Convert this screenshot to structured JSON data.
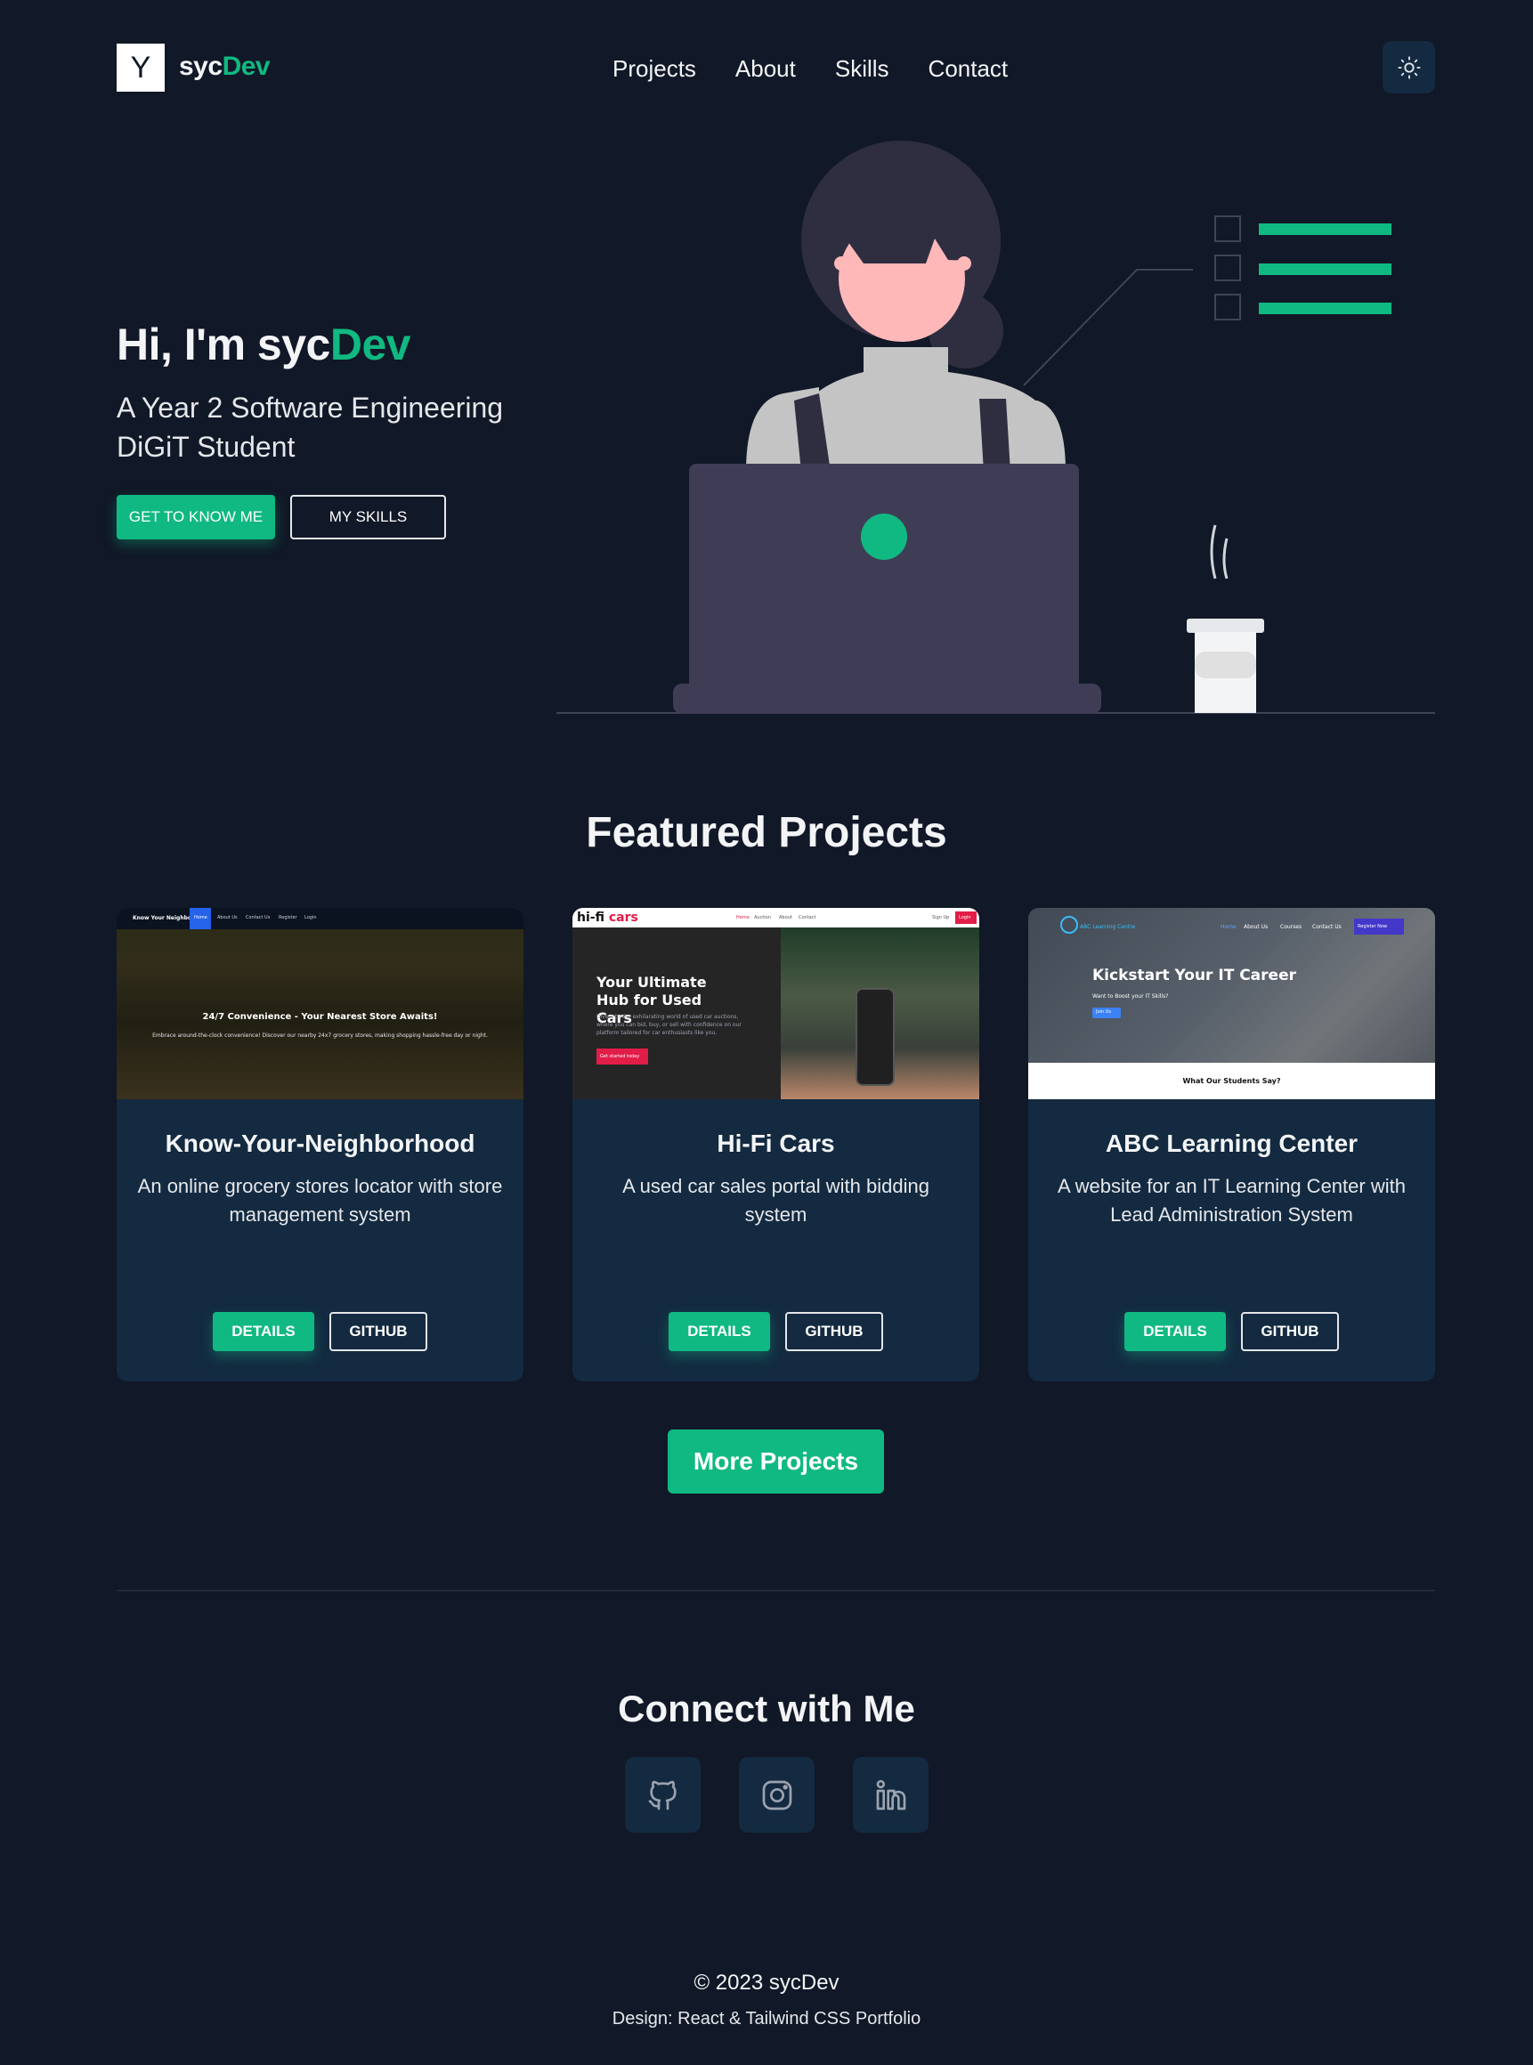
{
  "header": {
    "logo_letter": "Y",
    "brand_prefix": "syc",
    "brand_accent": "Dev",
    "nav": [
      "Projects",
      "About",
      "Skills",
      "Contact"
    ],
    "theme_icon": "sun-icon"
  },
  "hero": {
    "title_prefix": "Hi, I'm syc",
    "title_accent": "Dev",
    "subtitle": "A Year 2 Software Engineering DiGiT Student",
    "btn_primary": "GET TO KNOW ME",
    "btn_secondary": "MY SKILLS"
  },
  "featured": {
    "title": "Featured Projects",
    "projects": [
      {
        "title": "Know-Your-Neighborhood",
        "description": "An online grocery stores locator with store management system",
        "details_label": "DETAILS",
        "github_label": "GITHUB",
        "shot": {
          "brand": "Know Your Neighborhood",
          "nav": [
            "Home",
            "About Us",
            "Contact Us",
            "Register",
            "Login"
          ],
          "headline": "24/7 Convenience - Your Nearest Store Awaits!",
          "sub": "Embrace around-the-clock convenience! Discover our nearby 24x7 grocery stores, making shopping hassle-free day or night."
        }
      },
      {
        "title": "Hi-Fi Cars",
        "description": "A used car sales portal with bidding system",
        "details_label": "DETAILS",
        "github_label": "GITHUB",
        "shot": {
          "brand_a": "hi-fi",
          "brand_b": "cars",
          "nav": [
            "Home",
            "Auction",
            "About",
            "Contact"
          ],
          "signup": "Sign Up",
          "login": "Login",
          "headline": "Your Ultimate Hub for Used Cars",
          "sub": "Dive into the exhilarating world of used car auctions, where you can bid, buy, or sell with confidence on our platform tailored for car enthusiasts like you.",
          "cta": "Get started today"
        }
      },
      {
        "title": "ABC Learning Center",
        "description": "A website for an IT Learning Center with Lead Administration System",
        "details_label": "DETAILS",
        "github_label": "GITHUB",
        "shot": {
          "brand": "ABC Learning Centre",
          "nav": [
            "Home",
            "About Us",
            "Courses",
            "Contact Us"
          ],
          "register": "Register Now",
          "headline": "Kickstart Your IT Career",
          "sub": "Want to Boost your IT Skills?",
          "cta": "Join Us",
          "footer": "What Our Students Say?"
        }
      }
    ],
    "more_label": "More Projects"
  },
  "connect": {
    "title": "Connect with Me",
    "icons": [
      "github-icon",
      "instagram-icon",
      "linkedin-icon"
    ]
  },
  "footer": {
    "copyright": "© 2023 sycDev",
    "design": "Design: React & Tailwind CSS Portfolio"
  },
  "colors": {
    "background": "#111827",
    "card": "#132a40",
    "accent": "#10b981"
  }
}
